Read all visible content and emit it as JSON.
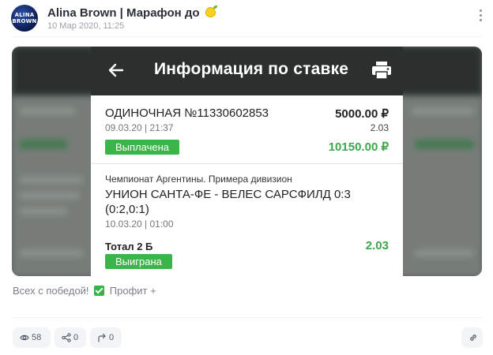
{
  "post": {
    "channel_name": "Alina Brown | Марафон до",
    "avatar_text_line1": "ALINA",
    "avatar_text_line2": "BROWN",
    "date": "10 Мар 2020, 11:25"
  },
  "screenshot": {
    "title": "Информация по ставке",
    "bet_number": "ОДИНОЧНАЯ №11330602853",
    "bet_amount": "5000.00 ₽",
    "bet_date": "09.03.20 | 21:37",
    "bet_odds": "2.03",
    "status_paid": "Выплачена",
    "payout": "10150.00 ₽",
    "championship": "Чемпионат Аргентины. Примера дивизион",
    "match": "УНИОН САНТА-ФЕ - ВЕЛЕС САРСФИЛД 0:3 (0:2,0:1)",
    "match_date": "10.03.20 | 01:00",
    "bet_type": "Тотал 2 Б",
    "bet_type_odds": "2.03",
    "status_won": "Выиграна"
  },
  "caption": {
    "text_before": "Всех с победой!",
    "text_after": "Профит +"
  },
  "footer": {
    "views": "58",
    "reposts": "0",
    "shares": "0"
  },
  "colors": {
    "accent_green": "#3bb54a",
    "app_bar": "#2b2f2e"
  }
}
